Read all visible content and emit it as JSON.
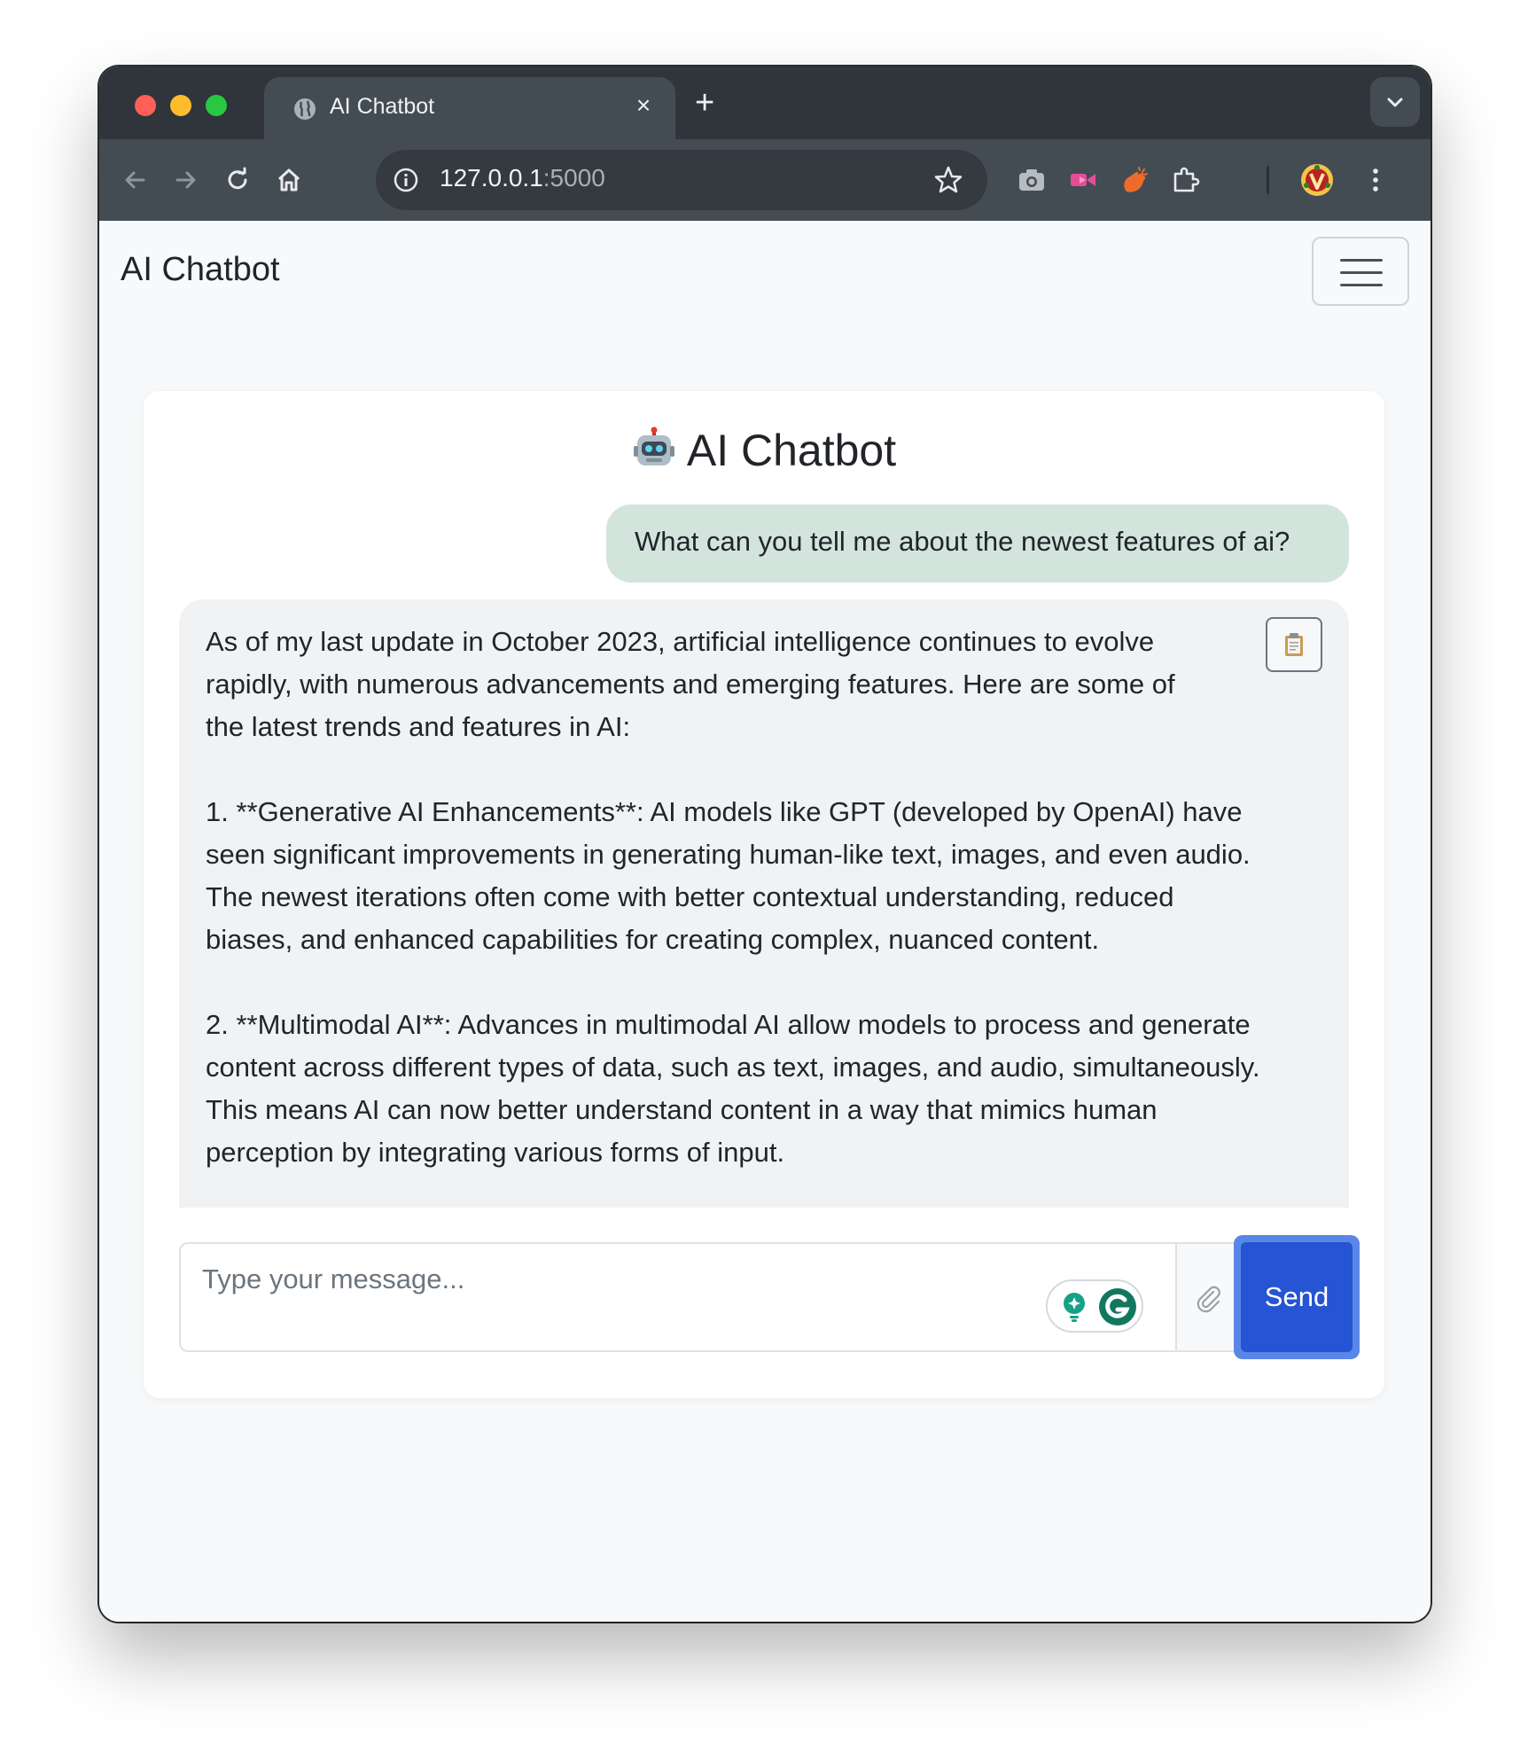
{
  "browser": {
    "tab_title": "AI Chatbot",
    "tab_close": "×",
    "new_tab": "+",
    "url_host": "127.0.0.1",
    "url_port": ":5000",
    "icons": [
      "globe-icon",
      "back-icon",
      "forward-icon",
      "reload-icon",
      "home-icon",
      "site-info-icon",
      "bookmark-star-icon",
      "camera-extension-icon",
      "video-extension-icon",
      "clap-extension-icon",
      "extensions-puzzle-icon",
      "profile-avatar",
      "more-menu-icon",
      "tab-search-chevron-icon"
    ]
  },
  "navbar": {
    "brand": "AI Chatbot"
  },
  "chat": {
    "title": "AI Chatbot",
    "user_message": "What can you tell me about the newest features of ai?",
    "bot_message": "As of my last update in October 2023, artificial intelligence continues to evolve\nrapidly, with numerous advancements and emerging features. Here are some of\nthe latest trends and features in AI:\n\n1. **Generative AI Enhancements**: AI models like GPT (developed by OpenAI) have\nseen significant improvements in generating human-like text, images, and even audio.\nThe newest iterations often come with better contextual understanding, reduced\nbiases, and enhanced capabilities for creating complex, nuanced content.\n\n2. **Multimodal AI**: Advances in multimodal AI allow models to process and generate\ncontent across different types of data, such as text, images, and audio, simultaneously.\nThis means AI can now better understand content in a way that mimics human\nperception by integrating various forms of input.",
    "input_placeholder": "Type your message...",
    "send_label": "Send"
  },
  "colors": {
    "user_bubble": "#d3e4dd",
    "bot_bubble": "#f1f2f4",
    "send_button": "#2554d4",
    "tab_strip": "#2f353a",
    "toolbar": "#434c53"
  }
}
